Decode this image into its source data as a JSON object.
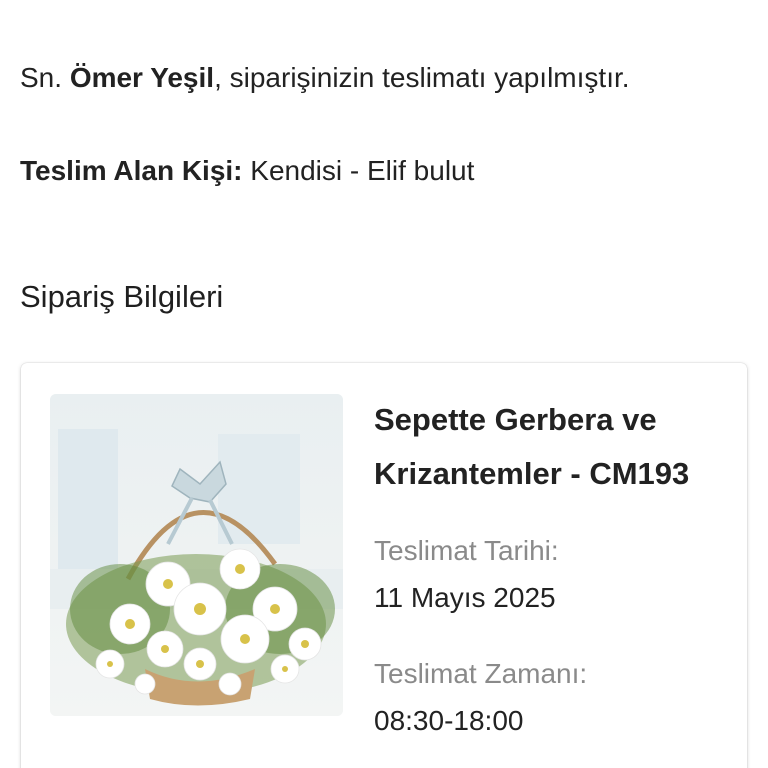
{
  "greeting": {
    "prefix": "Sn. ",
    "name": "Ömer Yeşil",
    "suffix": ", siparişinizin teslimatı yapılmıştır."
  },
  "receiver": {
    "label": "Teslim Alan Kişi:",
    "value": " Kendisi - Elif bulut"
  },
  "section": {
    "title": "Sipariş Bilgileri"
  },
  "order": {
    "product_name": "Sepette Gerbera ve Krizantemler - CM193",
    "delivery_date_label": "Teslimat Tarihi:",
    "delivery_date": "11 Mayıs 2025",
    "delivery_time_label": "Teslimat Zamanı:",
    "delivery_time": "08:30-18:00"
  }
}
